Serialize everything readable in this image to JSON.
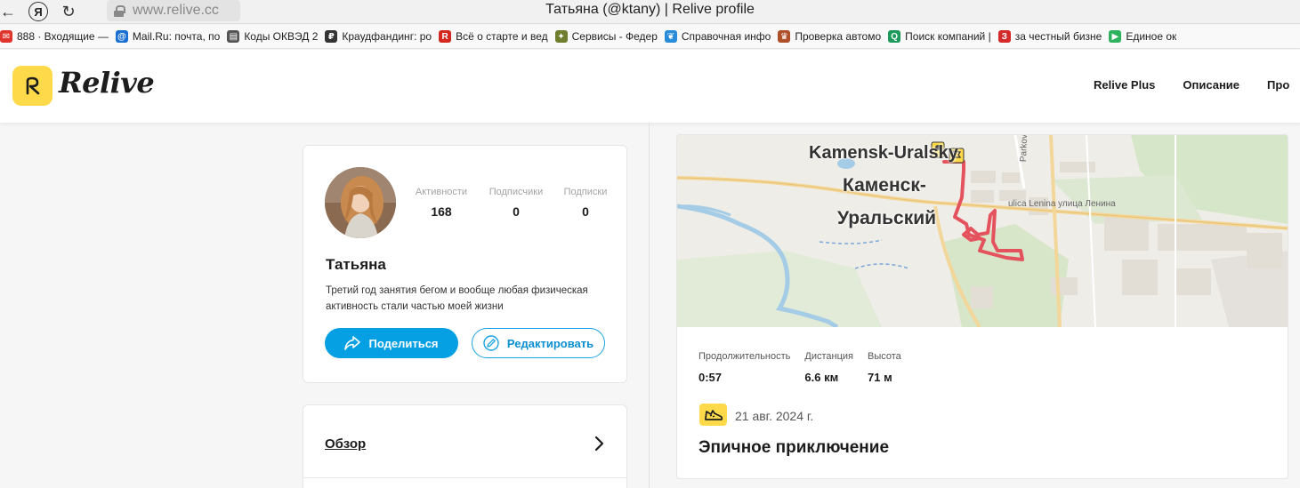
{
  "browser": {
    "window_title": "Татьяна (@ktany) | Relive profile",
    "url": "www.relive.cc",
    "bookmarks": [
      {
        "label": "888 · Входящие —",
        "icon": "mail-envelope-icon",
        "color": "#e0352c"
      },
      {
        "label": "Mail.Ru: почта, по",
        "icon": "at-sign-icon",
        "color": "#1a6fd3"
      },
      {
        "label": "Коды ОКВЭД 2",
        "icon": "document-icon",
        "color": "#555555"
      },
      {
        "label": "Краудфандинг: ро",
        "icon": "ruble-icon",
        "color": "#333333"
      },
      {
        "label": "Всё о старте и вед",
        "icon": "red-circle-r-icon",
        "color": "#d4271d"
      },
      {
        "label": "Сервисы - Федер",
        "icon": "emblem-icon",
        "color": "#6f7d2e"
      },
      {
        "label": "Справочная инфо",
        "icon": "leaf-icon",
        "color": "#2a8bd8"
      },
      {
        "label": "Проверка автомо",
        "icon": "gerb-icon",
        "color": "#b0502a"
      },
      {
        "label": "Поиск компаний |",
        "icon": "search-q-icon",
        "color": "#1b9a5a"
      },
      {
        "label": "за честный бизне",
        "icon": "za-icon",
        "color": "#d42a2a"
      },
      {
        "label": "Единое ок",
        "icon": "play-box-icon",
        "color": "#2db35e"
      }
    ]
  },
  "header": {
    "logo_text": "Relive",
    "nav": [
      "Relive Plus",
      "Описание",
      "Про"
    ]
  },
  "profile": {
    "name": "Татьяна",
    "bio": "Третий год занятия бегом и вообще любая физическая активность стали частью моей жизни",
    "stats": [
      {
        "label": "Активности",
        "value": "168"
      },
      {
        "label": "Подписчики",
        "value": "0"
      },
      {
        "label": "Подписки",
        "value": "0"
      }
    ],
    "share_label": "Поделиться",
    "edit_label": "Редактировать"
  },
  "overview": {
    "label": "Обзор"
  },
  "activity": {
    "map": {
      "city_latin": "Kamensk-Uralsky",
      "city_line1": "Каменск-",
      "city_line2": "Уральский",
      "street_park": "Parkova",
      "street_lenin": "ulica Lenina улица Ленина"
    },
    "stats": [
      {
        "label": "Продолжительность",
        "value": "0:57"
      },
      {
        "label": "Дистанция",
        "value": "6.6 км"
      },
      {
        "label": "Высота",
        "value": "71 м"
      }
    ],
    "date": "21 авг. 2024 г.",
    "title": "Эпичное приключение",
    "type_icon": "running-shoe-icon"
  },
  "colors": {
    "brand_yellow": "#fed94a",
    "share_blue": "#05a0e4",
    "route_red": "#e4535d"
  }
}
